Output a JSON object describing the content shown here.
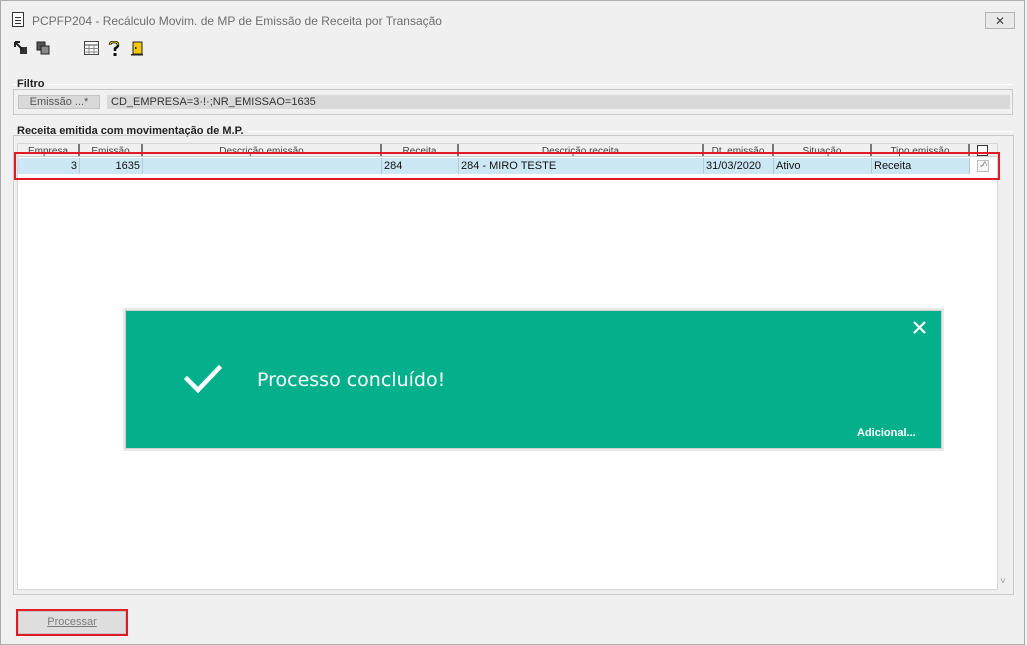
{
  "window": {
    "title": "PCPFP204 - Recálculo Movim. de MP de Emissão de Receita por Transação",
    "close_label": "✕"
  },
  "toolbar": {
    "icons": [
      "arrow-in-icon",
      "copy-icon",
      "calculator-icon",
      "help-icon",
      "exit-door-icon"
    ]
  },
  "filter": {
    "group_title": "Filtro",
    "button_label": "Emissão ...*",
    "value": "CD_EMPRESA=3·!·;NR_EMISSAO=1635"
  },
  "grid": {
    "group_title": "Receita emitida com movimentação de M.P.",
    "columns": [
      "Empresa",
      "Emissão",
      "Descrição emissão",
      "Receita",
      "Descrição receita",
      "Dt. emissão",
      "Situação",
      "Tipo emissão"
    ],
    "rows": [
      {
        "empresa": "3",
        "emissao": "1635",
        "descricao_emissao": "",
        "receita": "284",
        "descricao_receita": "284 - MIRO TESTE",
        "dt_emissao": "31/03/2020",
        "situacao": "Ativo",
        "tipo_emissao": "Receita",
        "checked": true
      }
    ]
  },
  "toast": {
    "message": "Processo concluído!",
    "more_label": "Adicional...",
    "close_label": "✕",
    "color": "#04b08b"
  },
  "actions": {
    "process_label": "Processar"
  },
  "colors": {
    "highlight": "#e01b24",
    "selected_row": "#cde8f5"
  }
}
